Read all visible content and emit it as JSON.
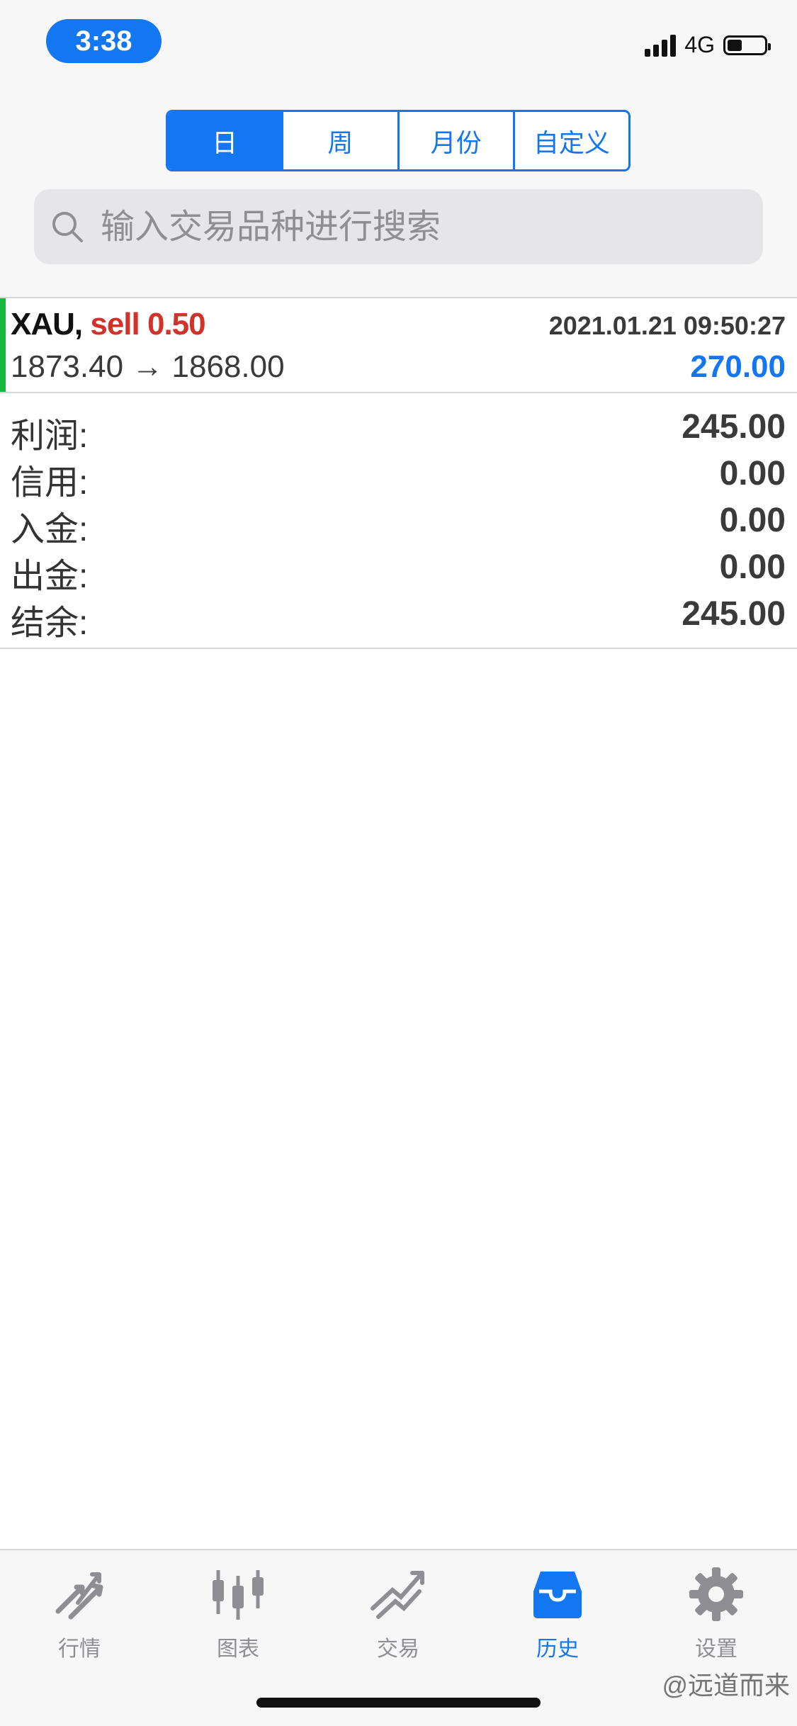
{
  "status_bar": {
    "time": "3:38",
    "network": "4G",
    "battery_level": 0.4
  },
  "period_tabs": [
    {
      "label": "日",
      "active": true
    },
    {
      "label": "周",
      "active": false
    },
    {
      "label": "月份",
      "active": false
    },
    {
      "label": "自定义",
      "active": false
    }
  ],
  "search": {
    "placeholder": "输入交易品种进行搜索",
    "icon": "search-icon"
  },
  "trade": {
    "symbol": "XAU,",
    "side": "sell 0.50",
    "datetime": "2021.01.21 09:50:27",
    "prices": "1873.40 → 1868.00",
    "profit": "270.00"
  },
  "summary": [
    {
      "label": "利润:",
      "value": "245.00"
    },
    {
      "label": "信用:",
      "value": "0.00"
    },
    {
      "label": "入金:",
      "value": "0.00"
    },
    {
      "label": "出金:",
      "value": "0.00"
    },
    {
      "label": "结余:",
      "value": "245.00"
    }
  ],
  "tabbar": [
    {
      "label": "行情",
      "icon": "quotes-arrows-icon",
      "active": false
    },
    {
      "label": "图表",
      "icon": "candlestick-chart-icon",
      "active": false
    },
    {
      "label": "交易",
      "icon": "trade-trend-icon",
      "active": false
    },
    {
      "label": "历史",
      "icon": "history-inbox-icon",
      "active": true
    },
    {
      "label": "设置",
      "icon": "gear-icon",
      "active": false
    }
  ],
  "watermark": "@远道而来",
  "colors": {
    "accent": "#1477f2",
    "sell": "#d0332a",
    "trade_accent": "#17b63f",
    "inactive_tab": "#8e8e93"
  }
}
